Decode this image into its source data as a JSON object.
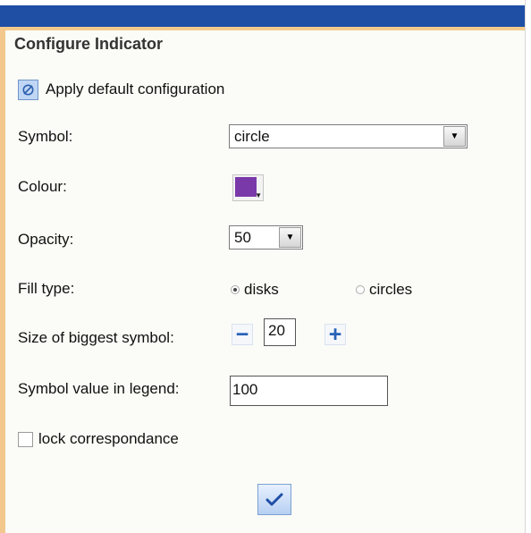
{
  "panel": {
    "title": "Configure Indicator"
  },
  "actions": {
    "apply_default": "Apply default configuration",
    "apply_default_icon": "reset-icon",
    "confirm_icon": "checkmark-icon"
  },
  "fields": {
    "symbol": {
      "label": "Symbol:",
      "value": "circle"
    },
    "colour": {
      "label": "Colour:",
      "value": "#7a39a9"
    },
    "opacity": {
      "label": "Opacity:",
      "value": "50"
    },
    "fill_type": {
      "label": "Fill type:",
      "selected": "disks",
      "options": [
        "disks",
        "circles"
      ]
    },
    "biggest_symbol_size": {
      "label": "Size of biggest symbol:",
      "value": "20",
      "decrease_icon": "minus-icon",
      "increase_icon": "plus-icon"
    },
    "legend_symbol_value": {
      "label": "Symbol value in legend:",
      "value": "100"
    },
    "lock": {
      "label": "lock correspondance",
      "checked": false
    }
  },
  "colors": {
    "header_blue": "#1f4ea5",
    "side_orange": "#f2c88c",
    "accent_blue": "#2862b8",
    "selected_colour": "#7a39a9"
  }
}
